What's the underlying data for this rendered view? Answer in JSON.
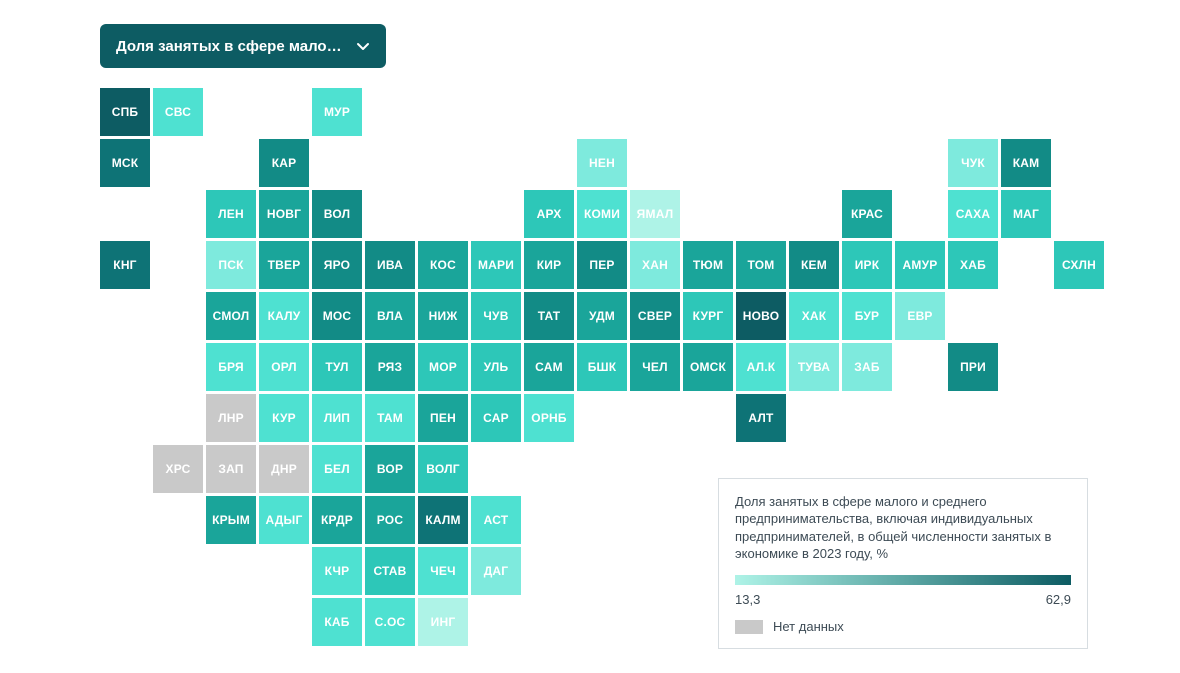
{
  "dropdown": {
    "label": "Доля занятых в сфере малог…"
  },
  "scale": {
    "min": 13.3,
    "max": 62.9,
    "min_label": "13,3",
    "max_label": "62,9",
    "nodata_label": "Нет данных",
    "nodata_color": "#c9c9c9",
    "colors": [
      "#aef3e7",
      "#7eeadd",
      "#4ee1d1",
      "#2dc7b8",
      "#1aa59a",
      "#128b86",
      "#0e7376",
      "#0d5c63"
    ]
  },
  "legend": {
    "title": "Доля занятых в сфере малого и среднего предпринимательства, включая индивидуальных предпринимателей, в общей численности занятых в экономике в 2023 году, %"
  },
  "cell": {
    "w": 50,
    "h": 48,
    "gap": 3
  },
  "regions": [
    {
      "code": "СПБ",
      "col": 0,
      "row": 0,
      "value": 58
    },
    {
      "code": "СВС",
      "col": 1,
      "row": 0,
      "value": 30
    },
    {
      "code": "МУР",
      "col": 4,
      "row": 0,
      "value": 26
    },
    {
      "code": "МСК",
      "col": 0,
      "row": 1,
      "value": 56
    },
    {
      "code": "КАР",
      "col": 3,
      "row": 1,
      "value": 50
    },
    {
      "code": "НЕН",
      "col": 9,
      "row": 1,
      "value": 22
    },
    {
      "code": "ЧУК",
      "col": 16,
      "row": 1,
      "value": 22
    },
    {
      "code": "КАМ",
      "col": 17,
      "row": 1,
      "value": 46
    },
    {
      "code": "ЛЕН",
      "col": 2,
      "row": 2,
      "value": 38
    },
    {
      "code": "НОВГ",
      "col": 3,
      "row": 2,
      "value": 42
    },
    {
      "code": "ВОЛ",
      "col": 4,
      "row": 2,
      "value": 48
    },
    {
      "code": "АРХ",
      "col": 8,
      "row": 2,
      "value": 34
    },
    {
      "code": "КОМИ",
      "col": 9,
      "row": 2,
      "value": 28
    },
    {
      "code": "ЯМАЛ",
      "col": 10,
      "row": 2,
      "value": 15
    },
    {
      "code": "КРАС",
      "col": 14,
      "row": 2,
      "value": 44
    },
    {
      "code": "САХА",
      "col": 16,
      "row": 2,
      "value": 26
    },
    {
      "code": "МАГ",
      "col": 17,
      "row": 2,
      "value": 36
    },
    {
      "code": "КНГ",
      "col": 0,
      "row": 3,
      "value": 52
    },
    {
      "code": "ПСК",
      "col": 2,
      "row": 3,
      "value": 22
    },
    {
      "code": "ТВЕР",
      "col": 3,
      "row": 3,
      "value": 40
    },
    {
      "code": "ЯРО",
      "col": 4,
      "row": 3,
      "value": 46
    },
    {
      "code": "ИВА",
      "col": 5,
      "row": 3,
      "value": 48
    },
    {
      "code": "КОС",
      "col": 6,
      "row": 3,
      "value": 40
    },
    {
      "code": "МАРИ",
      "col": 7,
      "row": 3,
      "value": 34
    },
    {
      "code": "КИР",
      "col": 8,
      "row": 3,
      "value": 40
    },
    {
      "code": "ПЕР",
      "col": 9,
      "row": 3,
      "value": 46
    },
    {
      "code": "ХАН",
      "col": 10,
      "row": 3,
      "value": 20
    },
    {
      "code": "ТЮМ",
      "col": 11,
      "row": 3,
      "value": 44
    },
    {
      "code": "ТОМ",
      "col": 12,
      "row": 3,
      "value": 42
    },
    {
      "code": "КЕМ",
      "col": 13,
      "row": 3,
      "value": 50
    },
    {
      "code": "ИРК",
      "col": 14,
      "row": 3,
      "value": 36
    },
    {
      "code": "АМУР",
      "col": 15,
      "row": 3,
      "value": 32
    },
    {
      "code": "ХАБ",
      "col": 16,
      "row": 3,
      "value": 38
    },
    {
      "code": "СХЛН",
      "col": 18,
      "row": 3,
      "value": 34
    },
    {
      "code": "СМОЛ",
      "col": 2,
      "row": 4,
      "value": 40
    },
    {
      "code": "КАЛУ",
      "col": 3,
      "row": 4,
      "value": 30
    },
    {
      "code": "МОС",
      "col": 4,
      "row": 4,
      "value": 46
    },
    {
      "code": "ВЛА",
      "col": 5,
      "row": 4,
      "value": 44
    },
    {
      "code": "НИЖ",
      "col": 6,
      "row": 4,
      "value": 42
    },
    {
      "code": "ЧУВ",
      "col": 7,
      "row": 4,
      "value": 38
    },
    {
      "code": "ТАТ",
      "col": 8,
      "row": 4,
      "value": 48
    },
    {
      "code": "УДМ",
      "col": 9,
      "row": 4,
      "value": 44
    },
    {
      "code": "СВЕР",
      "col": 10,
      "row": 4,
      "value": 46
    },
    {
      "code": "КУРГ",
      "col": 11,
      "row": 4,
      "value": 38
    },
    {
      "code": "НОВО",
      "col": 12,
      "row": 4,
      "value": 58
    },
    {
      "code": "ХАК",
      "col": 13,
      "row": 4,
      "value": 30
    },
    {
      "code": "БУР",
      "col": 14,
      "row": 4,
      "value": 28
    },
    {
      "code": "ЕВР",
      "col": 15,
      "row": 4,
      "value": 24
    },
    {
      "code": "БРЯ",
      "col": 2,
      "row": 5,
      "value": 26
    },
    {
      "code": "ОРЛ",
      "col": 3,
      "row": 5,
      "value": 30
    },
    {
      "code": "ТУЛ",
      "col": 4,
      "row": 5,
      "value": 36
    },
    {
      "code": "РЯЗ",
      "col": 5,
      "row": 5,
      "value": 40
    },
    {
      "code": "МОР",
      "col": 6,
      "row": 5,
      "value": 36
    },
    {
      "code": "УЛЬ",
      "col": 7,
      "row": 5,
      "value": 34
    },
    {
      "code": "САМ",
      "col": 8,
      "row": 5,
      "value": 42
    },
    {
      "code": "БШК",
      "col": 9,
      "row": 5,
      "value": 36
    },
    {
      "code": "ЧЕЛ",
      "col": 10,
      "row": 5,
      "value": 40
    },
    {
      "code": "ОМСК",
      "col": 11,
      "row": 5,
      "value": 40
    },
    {
      "code": "АЛ.К",
      "col": 12,
      "row": 5,
      "value": 28
    },
    {
      "code": "ТУВА",
      "col": 13,
      "row": 5,
      "value": 22
    },
    {
      "code": "ЗАБ",
      "col": 14,
      "row": 5,
      "value": 24
    },
    {
      "code": "ПРИ",
      "col": 16,
      "row": 5,
      "value": 46
    },
    {
      "code": "ЛНР",
      "col": 2,
      "row": 6,
      "value": null
    },
    {
      "code": "КУР",
      "col": 3,
      "row": 6,
      "value": 28
    },
    {
      "code": "ЛИП",
      "col": 4,
      "row": 6,
      "value": 30
    },
    {
      "code": "ТАМ",
      "col": 5,
      "row": 6,
      "value": 30
    },
    {
      "code": "ПЕН",
      "col": 6,
      "row": 6,
      "value": 44
    },
    {
      "code": "САР",
      "col": 7,
      "row": 6,
      "value": 34
    },
    {
      "code": "ОРНБ",
      "col": 8,
      "row": 6,
      "value": 30
    },
    {
      "code": "АЛТ",
      "col": 12,
      "row": 6,
      "value": 52
    },
    {
      "code": "ХРС",
      "col": 1,
      "row": 7,
      "value": null
    },
    {
      "code": "ЗАП",
      "col": 2,
      "row": 7,
      "value": null
    },
    {
      "code": "ДНР",
      "col": 3,
      "row": 7,
      "value": null
    },
    {
      "code": "БЕЛ",
      "col": 4,
      "row": 7,
      "value": 28
    },
    {
      "code": "ВОР",
      "col": 5,
      "row": 7,
      "value": 40
    },
    {
      "code": "ВОЛГ",
      "col": 6,
      "row": 7,
      "value": 36
    },
    {
      "code": "КРЫМ",
      "col": 2,
      "row": 8,
      "value": 40
    },
    {
      "code": "АДЫГ",
      "col": 3,
      "row": 8,
      "value": 30
    },
    {
      "code": "КРДР",
      "col": 4,
      "row": 8,
      "value": 44
    },
    {
      "code": "РОС",
      "col": 5,
      "row": 8,
      "value": 44
    },
    {
      "code": "КАЛМ",
      "col": 6,
      "row": 8,
      "value": 56
    },
    {
      "code": "АСТ",
      "col": 7,
      "row": 8,
      "value": 28
    },
    {
      "code": "КЧР",
      "col": 4,
      "row": 9,
      "value": 26
    },
    {
      "code": "СТАВ",
      "col": 5,
      "row": 9,
      "value": 34
    },
    {
      "code": "ЧЕЧ",
      "col": 6,
      "row": 9,
      "value": 26
    },
    {
      "code": "ДАГ",
      "col": 7,
      "row": 9,
      "value": 24
    },
    {
      "code": "КАБ",
      "col": 4,
      "row": 10,
      "value": 28
    },
    {
      "code": "С.ОС",
      "col": 5,
      "row": 10,
      "value": 28
    },
    {
      "code": "ИНГ",
      "col": 6,
      "row": 10,
      "value": 16
    }
  ]
}
